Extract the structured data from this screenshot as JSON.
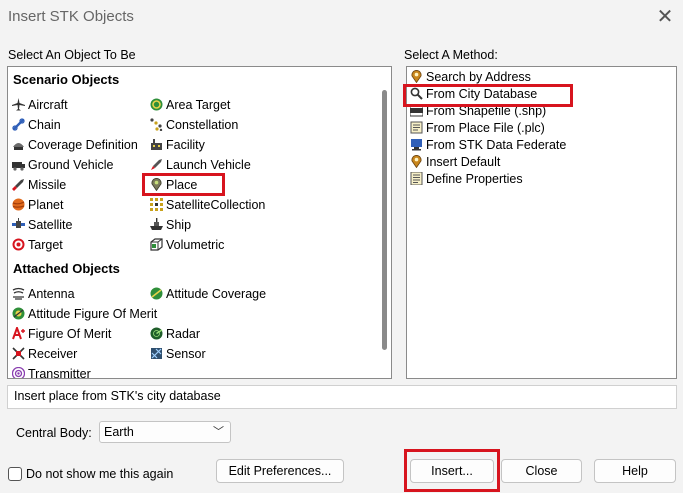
{
  "window": {
    "title": "Insert STK Objects",
    "close_glyph": "✕"
  },
  "left_panel": {
    "label": "Select An Object To Be",
    "categories": [
      {
        "name": "Scenario Objects",
        "items": [
          {
            "label": "Aircraft",
            "icon": "aircraft-icon"
          },
          {
            "label": "Area Target",
            "icon": "area-target-icon"
          },
          {
            "label": "Chain",
            "icon": "chain-icon"
          },
          {
            "label": "Constellation",
            "icon": "constellation-icon"
          },
          {
            "label": "Coverage Definition",
            "icon": "coverage-definition-icon"
          },
          {
            "label": "Facility",
            "icon": "facility-icon"
          },
          {
            "label": "Ground Vehicle",
            "icon": "ground-vehicle-icon"
          },
          {
            "label": "Launch Vehicle",
            "icon": "launch-vehicle-icon"
          },
          {
            "label": "Missile",
            "icon": "missile-icon"
          },
          {
            "label": "Place",
            "icon": "place-icon"
          },
          {
            "label": "Planet",
            "icon": "planet-icon"
          },
          {
            "label": "SatelliteCollection",
            "icon": "satellite-collection-icon"
          },
          {
            "label": "Satellite",
            "icon": "satellite-icon"
          },
          {
            "label": "Ship",
            "icon": "ship-icon"
          },
          {
            "label": "Target",
            "icon": "target-icon"
          },
          {
            "label": "Volumetric",
            "icon": "volumetric-icon"
          }
        ]
      },
      {
        "name": "Attached Objects",
        "items": [
          {
            "label": "Antenna",
            "icon": "antenna-icon"
          },
          {
            "label": "Attitude Coverage",
            "icon": "attitude-coverage-icon"
          },
          {
            "label": "Attitude Figure Of Merit",
            "icon": "attitude-figure-of-merit-icon"
          },
          {
            "label": "Figure Of Merit",
            "icon": "figure-of-merit-icon"
          },
          {
            "label": "Radar",
            "icon": "radar-icon"
          },
          {
            "label": "Receiver",
            "icon": "receiver-icon"
          },
          {
            "label": "Sensor",
            "icon": "sensor-icon"
          },
          {
            "label": "Transmitter",
            "icon": "transmitter-icon"
          }
        ]
      }
    ],
    "selected": "Place"
  },
  "right_panel": {
    "label": "Select A Method:",
    "methods": [
      {
        "label": "Search by Address",
        "icon": "pin-icon"
      },
      {
        "label": "From City Database",
        "icon": "magnifier-icon"
      },
      {
        "label": "From Shapefile (.shp)",
        "icon": "shapefile-icon"
      },
      {
        "label": "From Place File (.plc)",
        "icon": "file-icon"
      },
      {
        "label": "From STK Data Federate",
        "icon": "data-federate-icon"
      },
      {
        "label": "Insert Default",
        "icon": "pin-icon"
      },
      {
        "label": "Define Properties",
        "icon": "properties-icon"
      }
    ],
    "selected": "From City Database"
  },
  "description": "Insert place from STK's city database",
  "central_body": {
    "label": "Central Body:",
    "value": "Earth"
  },
  "checkbox": {
    "label": "Do not show me this again",
    "checked": false
  },
  "buttons": {
    "edit_preferences": "Edit Preferences...",
    "insert": "Insert...",
    "close": "Close",
    "help": "Help"
  },
  "colors": {
    "highlight": "#d7141e",
    "background": "#f3f3f3",
    "panel": "#ffffff"
  }
}
